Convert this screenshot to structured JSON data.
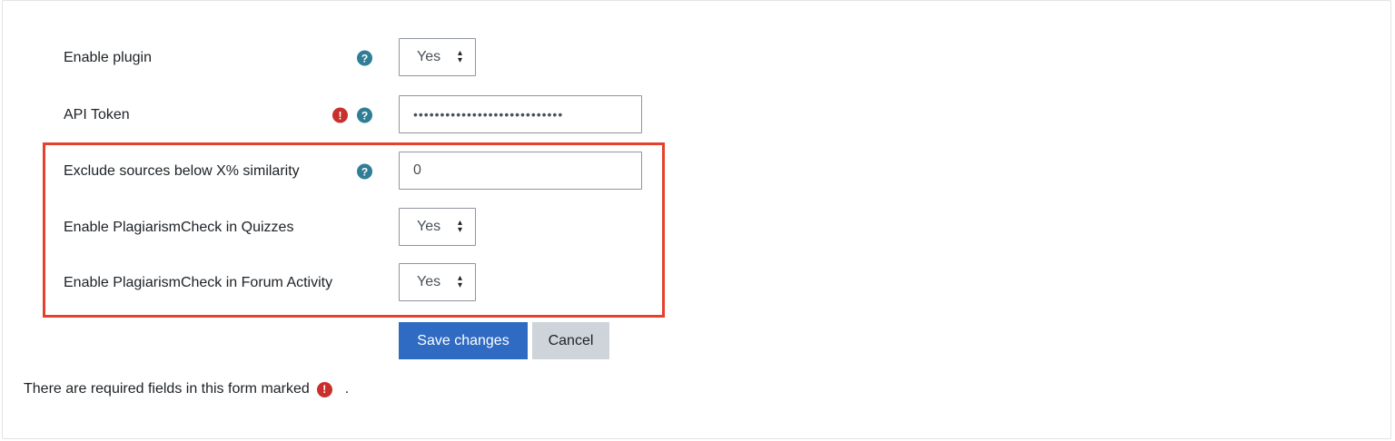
{
  "form": {
    "enable_plugin": {
      "label": "Enable plugin",
      "value": "Yes",
      "help_icon": "question-circle-icon"
    },
    "api_token": {
      "label": "API Token",
      "value": "••••••••••••••••••••••••••••",
      "required_icon": "exclamation-circle-icon",
      "help_icon": "question-circle-icon"
    },
    "exclude_sources": {
      "label": "Exclude sources below X% similarity",
      "value": "0",
      "help_icon": "question-circle-icon"
    },
    "quizzes": {
      "label": "Enable PlagiarismCheck in Quizzes",
      "value": "Yes"
    },
    "forum": {
      "label": "Enable PlagiarismCheck in Forum Activity",
      "value": "Yes"
    }
  },
  "actions": {
    "save_label": "Save changes",
    "cancel_label": "Cancel"
  },
  "footer": {
    "required_note": "There are required fields in this form marked",
    "trailing": "."
  },
  "colors": {
    "help": "#2f7e95",
    "required": "#c9302c",
    "primary": "#2f6bc2",
    "secondary": "#ced4da",
    "highlight": "#e5412d"
  }
}
